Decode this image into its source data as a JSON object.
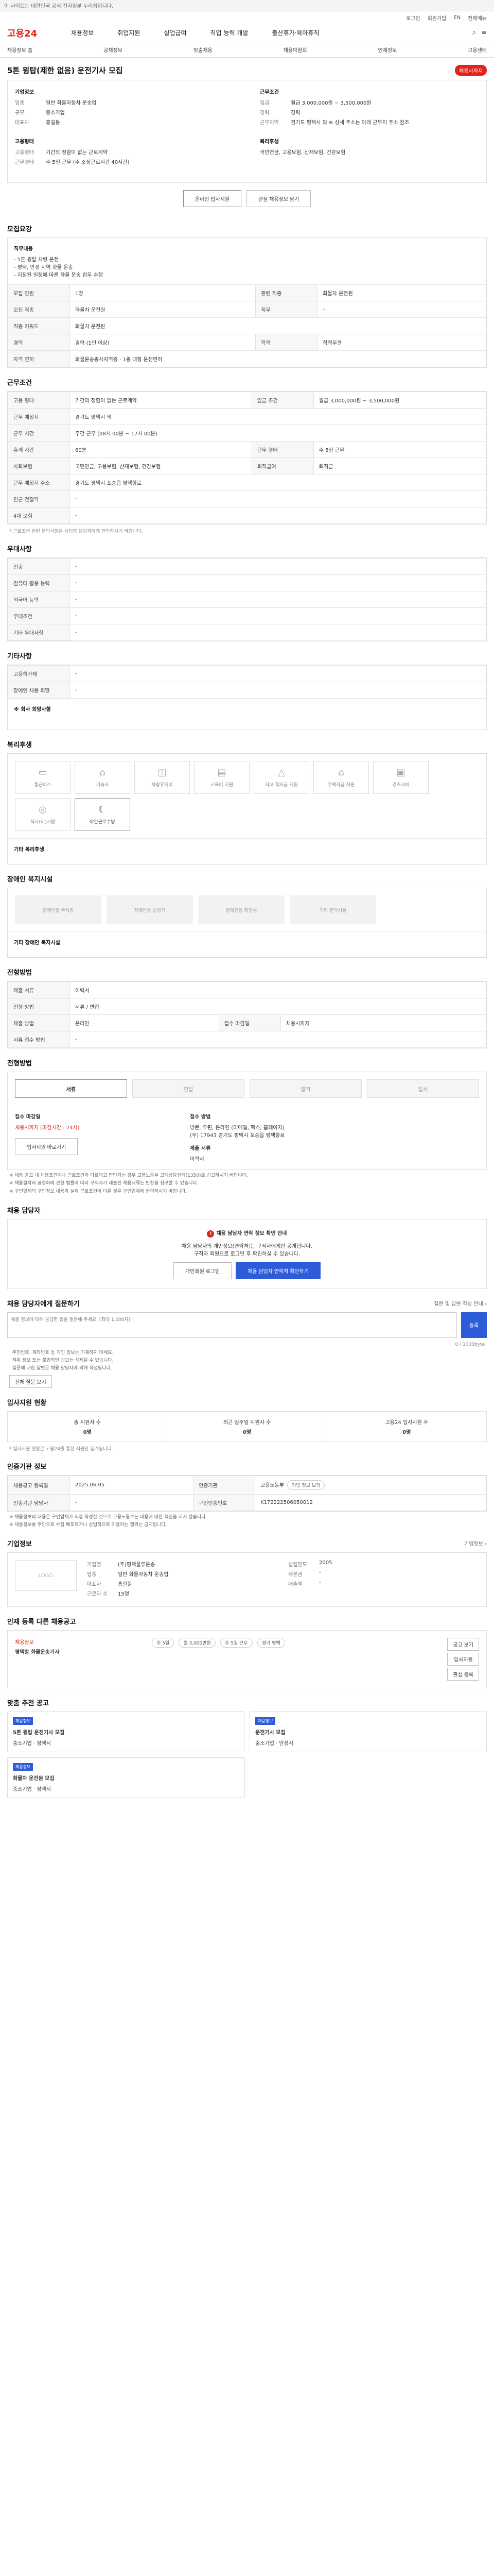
{
  "topbar": {
    "notice": "이 사이트는 대한민국 공식 전자정부 누리집입니다."
  },
  "util": {
    "links": [
      "로그인",
      "회원가입",
      "EN",
      "전체메뉴"
    ]
  },
  "header": {
    "logo": "고용24",
    "nav": [
      "채용정보",
      "취업지원",
      "실업급여",
      "직업 능력 개발",
      "출산휴가·육아휴직"
    ]
  },
  "subnav": {
    "items": [
      "채용정보 홈",
      "공채정보",
      "맞춤채용",
      "채용박람회",
      "인재정보",
      "고용센터"
    ]
  },
  "job": {
    "title": "5톤 윙탑(제한 없음) 운전기사 모집",
    "badge": "채용시까지",
    "summary": {
      "left_title": "기업정보",
      "left": [
        {
          "k": "업종",
          "v": "일반 화물자동차 운송업"
        },
        {
          "k": "규모",
          "v": "중소기업"
        },
        {
          "k": "대표자",
          "v": "홍길동"
        }
      ],
      "left_title2": "고용형태",
      "left2": [
        {
          "k": "고용형태",
          "v": "기간의 정함이 없는 근로계약"
        },
        {
          "k": "근무형태",
          "v": "주 5일 근무 (주 소정근로시간 40시간)"
        }
      ],
      "right_title": "근무조건",
      "right": [
        {
          "k": "임금",
          "v": "월급 3,000,000원 ~ 3,500,000원"
        },
        {
          "k": "경력",
          "v": "경력"
        },
        {
          "k": "근무지역",
          "v": "경기도 평택시 외 ※ 상세 주소는 아래 근무지 주소 참조"
        }
      ],
      "right_title2": "복리후생",
      "right2": [
        {
          "k": "",
          "v": "국민연금, 고용보험, 산재보험, 건강보험"
        }
      ],
      "btn_apply": "온라인 입사지원",
      "btn_scrap": "관심 채용정보 담기"
    }
  },
  "sec_job_desc": {
    "title": "모집요강",
    "lead_title": "직무내용",
    "lead": [
      "- 5톤 윙탑 차량 운전",
      "- 평택, 안성 지역 화물 운송",
      "- 지정된 일정에 따른 화물 운송 업무 수행"
    ],
    "rows": [
      {
        "k": "모집 인원",
        "v": "1명",
        "k2": "관련 직종",
        "v2": "화물차 운전원"
      },
      {
        "k": "모집 직종",
        "v": "화물차 운전원",
        "k2": "직무",
        "v2": "-"
      },
      {
        "k": "직종 키워드",
        "v": "화물차 운전원",
        "k2": "",
        "v2": ""
      },
      {
        "k": "경력",
        "v": "경력 (1년 이상)",
        "k2": "학력",
        "v2": "학력무관"
      },
      {
        "k": "자격 면허",
        "v": "화물운송종사자격증 · 1종 대형 운전면허",
        "k2": "",
        "v2": ""
      }
    ]
  },
  "sec_work": {
    "title": "근무조건",
    "rows": [
      {
        "k": "고용 형태",
        "v": "기간의 정함이 없는 근로계약",
        "k2": "임금 조건",
        "v2": "월급 3,000,000원 ~ 3,500,000원"
      },
      {
        "k": "근무 예정지",
        "v": "경기도 평택시 외",
        "k2": "",
        "v2": ""
      },
      {
        "k": "근무 시간",
        "v": "주간 근무 (08시 00분 ~ 17시 00분)",
        "k2": "",
        "v2": ""
      },
      {
        "k": "휴게 시간",
        "v": "60분",
        "k2": "근무 형태",
        "v2": "주 5일 근무"
      },
      {
        "k": "사회보험",
        "v": "국민연금, 고용보험, 산재보험, 건강보험",
        "k2": "퇴직급여",
        "v2": "퇴직금"
      },
      {
        "k": "근무 예정지 주소",
        "v": "경기도 평택시 포승읍 평택항로",
        "k2": "",
        "v2": ""
      },
      {
        "k": "인근 전철역",
        "v": "-",
        "k2": "",
        "v2": ""
      },
      {
        "k": "4대 보험",
        "v": "-",
        "k2": "",
        "v2": ""
      }
    ],
    "note": "* 근로조건 관련 문의사항은 사업장 담당자에게 연락하시기 바랍니다."
  },
  "sec_pref": {
    "title": "우대사항",
    "rows": [
      {
        "k": "전공",
        "v": "-"
      },
      {
        "k": "컴퓨터 활용 능력",
        "v": "-"
      },
      {
        "k": "외국어 능력",
        "v": "-"
      },
      {
        "k": "우대조건",
        "v": "-"
      },
      {
        "k": "기타 우대사항",
        "v": "-"
      }
    ]
  },
  "sec_etc": {
    "title": "기타사항",
    "rows": [
      {
        "k": "고용허가제",
        "v": "-"
      },
      {
        "k": "장애인 채용 희망",
        "v": "-"
      }
    ],
    "extra_title": "※ 회사 희망사항"
  },
  "sec_welfare": {
    "title": "복리후생",
    "items": [
      {
        "name": "통근버스",
        "icon": "bus-icon",
        "on": false
      },
      {
        "name": "기숙사",
        "icon": "bed-icon",
        "on": false
      },
      {
        "name": "차량유지비",
        "icon": "car-icon",
        "on": false
      },
      {
        "name": "교육비 지원",
        "icon": "book-icon",
        "on": false
      },
      {
        "name": "자녀 학자금 지원",
        "icon": "cap-icon",
        "on": false
      },
      {
        "name": "주택자금 지원",
        "icon": "house-icon",
        "on": false
      },
      {
        "name": "경조사비",
        "icon": "gift-icon",
        "on": false
      },
      {
        "name": "식사(비)지원",
        "icon": "meal-icon",
        "on": false
      },
      {
        "name": "야간근로수당",
        "icon": "moon-icon",
        "on": true
      }
    ],
    "other_title": "기타 복리후생"
  },
  "sec_disab": {
    "title": "장애인 복지시설",
    "items": [
      "장애인용 주차장",
      "장애인용 승강기",
      "장애인용 화장실",
      "기타 편의시설"
    ],
    "other_title": "기타 장애인 복지시설"
  },
  "sec_sel": {
    "title": "전형방법",
    "rows": [
      {
        "k": "제출 서류",
        "v": "이력서"
      },
      {
        "k": "전형 방법",
        "v": "서류 / 면접"
      },
      {
        "k": "제출 방법",
        "v": "온라인",
        "k2": "접수 마감일",
        "v2": "채용시까지"
      },
      {
        "k": "서류 접수 방법",
        "v": "-"
      }
    ]
  },
  "sec_proc": {
    "title": "전형방법",
    "steps": [
      "서류",
      "면접",
      "합격",
      "입사"
    ],
    "active": 0,
    "left_title": "접수 마감일",
    "left_val": "채용시까지 (마감시간 : 24시)",
    "right_title": "접수 방법",
    "right_lines": [
      "방문, 우편, 온라인 (이메일, 팩스, 홈페이지)",
      "(우) 17943 경기도 평택시 포승읍 평택항로"
    ],
    "right_title2": "제출 서류",
    "right_val2": "이력서",
    "btn": "입사지원 바로가기",
    "notes": [
      "※ 채용 공고 내 채용조건이나 근로조건과 다르다고 판단되는 경우 고용노동부 고객상담센터(1350)로 신고하시기 바랍니다.",
      "※ 채용절차의 공정화에 관한 법률에 따라 구직자가 제출한 채용서류는 반환을 청구할 수 있습니다.",
      "※ 구인업체의 구인정보 내용과 실제 근로조건이 다른 경우 구인업체에 문의하시기 바랍니다."
    ]
  },
  "sec_contact": {
    "title": "채용 담당자",
    "warn": "채용 담당자 연락 정보 확인 안내",
    "lines": [
      "채용 담당자의 개인정보(연락처)는 구직자에게만 공개됩니다.",
      "구직자 회원으로 로그인 후 확인하실 수 있습니다."
    ],
    "btn1": "개인회원 로그인",
    "btn2": "채용 담당자 연락처 확인하기"
  },
  "sec_qa": {
    "title": "채용 담당자에게 질문하기",
    "side": "질문 및 답변 작성 안내 ›",
    "placeholder": "채용 정보에 대해 궁금한 점을 질문해 주세요. (최대 1,000자)",
    "counter": "0 / 1000byte",
    "send": "등록",
    "bullets": [
      "· 주민번호, 계좌번호 등 개인 정보는 기재하지 마세요.",
      "· 허위 정보 또는 불법적인 광고는 삭제될 수 있습니다.",
      "· 질문에 대한 답변은 채용 담당자에 의해 작성됩니다."
    ],
    "more_btn": "전체 질문 보기"
  },
  "sec_stats": {
    "title": "입사지원 현황",
    "items": [
      {
        "k": "총 지원자 수",
        "v": "0명"
      },
      {
        "k": "최근 일주일 지원자 수",
        "v": "0명"
      },
      {
        "k": "고용24 입사지원 수",
        "v": "0명"
      }
    ],
    "note": "* 입사지원 현황은 고용24를 통한 지원만 집계됩니다."
  },
  "sec_reg": {
    "title": "인증기관 정보",
    "rows": [
      {
        "k": "채용공고 등록일",
        "v": "2025.06.05",
        "k2": "인증기관",
        "v2": "고용노동부",
        "btn": "기업 정보 보기"
      },
      {
        "k": "인증기관 담당자",
        "v": "-",
        "k2": "구인인증번호",
        "v2": "K172222506050012"
      }
    ],
    "notes": [
      "※ 채용정보의 내용은 구인업체가 직접 작성한 것으로 고용노동부는 내용에 대한 책임을 지지 않습니다.",
      "※ 채용정보를 무단으로 수집·배포하거나 상업적으로 이용하는 행위는 금지됩니다."
    ]
  },
  "sec_company": {
    "title": "기업정보",
    "more": "기업정보 ›",
    "logo": "LOGO",
    "rows": [
      {
        "k": "기업명",
        "v": "(주)평택물류운송"
      },
      {
        "k": "업종",
        "v": "일반 화물자동차 운송업"
      },
      {
        "k": "대표자",
        "v": "홍길동"
      },
      {
        "k": "근로자 수",
        "v": "15명"
      }
    ],
    "rows2": [
      {
        "k": "설립연도",
        "v": "2005"
      },
      {
        "k": "자본금",
        "v": "-"
      },
      {
        "k": "매출액",
        "v": "-"
      }
    ]
  },
  "sec_other": {
    "title": "인재 등록 다른 채용공고",
    "card_title": "채용정보",
    "card_name": "평택항 화물운송기사",
    "tags": [
      "주 5일",
      "월 3,000만원",
      "주 5일 근무",
      "경기 평택"
    ],
    "side_btns": [
      "공고 보기",
      "입사지원",
      "관심 등록"
    ]
  },
  "sec_similar": {
    "title": "맞춤 추천 공고",
    "cards": [
      {
        "tag": "채용정보",
        "title": "5톤 윙탑 운전기사 모집",
        "company": "중소기업 · 평택시"
      },
      {
        "tag": "채용정보",
        "title": "운전기사 모집",
        "company": "중소기업 · 안성시"
      },
      {
        "tag": "채용정보",
        "title": "화물차 운전원 모집",
        "company": "중소기업 · 평택시"
      }
    ]
  }
}
